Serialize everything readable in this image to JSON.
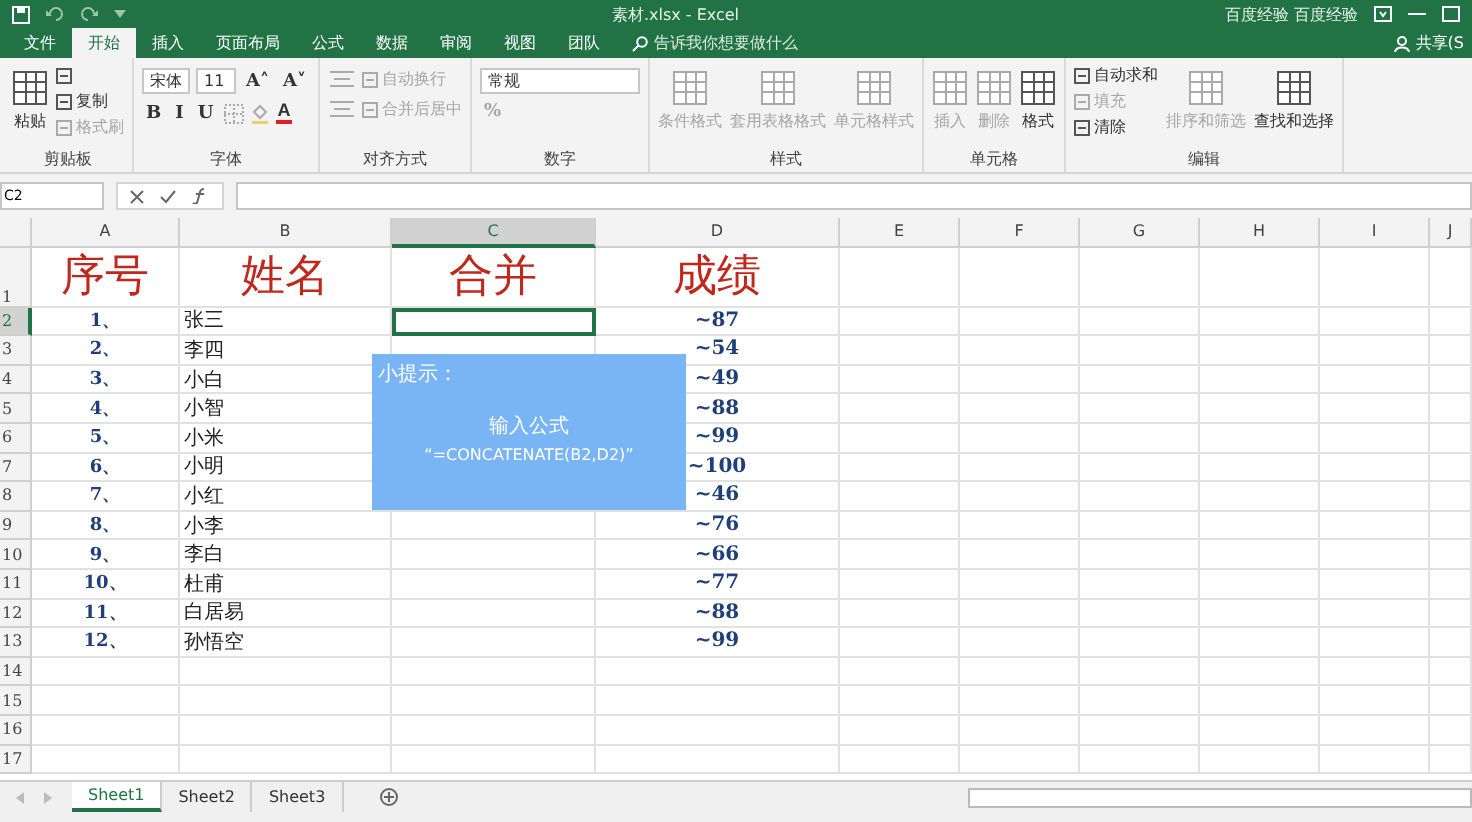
{
  "window": {
    "title": "素材.xlsx - Excel",
    "user": "百度经验 百度经验",
    "share": "共享(S"
  },
  "ribbon_tabs": [
    {
      "label": "文件",
      "selected": false
    },
    {
      "label": "开始",
      "selected": true
    },
    {
      "label": "插入",
      "selected": false
    },
    {
      "label": "页面布局",
      "selected": false
    },
    {
      "label": "公式",
      "selected": false
    },
    {
      "label": "数据",
      "selected": false
    },
    {
      "label": "审阅",
      "selected": false
    },
    {
      "label": "视图",
      "selected": false
    },
    {
      "label": "团队",
      "selected": false
    }
  ],
  "tell_me": {
    "placeholder": "告诉我你想要做什么"
  },
  "ribbon": {
    "groups": [
      {
        "label": "剪贴板",
        "items": [
          {
            "kind": "big",
            "label": "粘贴",
            "disabled": false
          },
          {
            "kind": "small",
            "disabled": false
          },
          {
            "kind": "small",
            "label": "复制",
            "disabled": false
          },
          {
            "kind": "small",
            "label": "格式刷",
            "disabled": true
          }
        ]
      },
      {
        "label": "字体",
        "top_row": [
          {
            "kind": "field",
            "label": "宋体",
            "disabled": false
          },
          {
            "kind": "field",
            "label": "11",
            "disabled": false
          },
          {
            "kind": "char",
            "label": "A˄",
            "disabled": false
          },
          {
            "kind": "char",
            "label": "A˅",
            "disabled": false
          }
        ],
        "bottom_row": [
          {
            "kind": "char",
            "label": "B",
            "disabled": false
          },
          {
            "kind": "char",
            "label": "I",
            "disabled": false
          },
          {
            "kind": "char",
            "label": "U",
            "disabled": false
          },
          {
            "kind": "border",
            "disabled": true
          },
          {
            "kind": "fill",
            "disabled": true
          },
          {
            "kind": "fontcolor",
            "label": "A",
            "disabled": false
          }
        ]
      },
      {
        "label": "对齐方式",
        "top_row": [
          {
            "kind": "align",
            "disabled": true
          },
          {
            "kind": "small",
            "label": "自动换行",
            "disabled": true
          }
        ],
        "bottom_row": [
          {
            "kind": "align",
            "disabled": true
          },
          {
            "kind": "small",
            "label": "合并后居中",
            "disabled": true
          }
        ]
      },
      {
        "label": "数字",
        "top_row": [
          {
            "kind": "field",
            "label": "常规",
            "disabled": false
          }
        ],
        "bottom_row": [
          {
            "kind": "char",
            "label": "%",
            "disabled": true
          }
        ]
      },
      {
        "label": "样式",
        "items": [
          {
            "kind": "big",
            "label": "条件格式",
            "disabled": true
          },
          {
            "kind": "big",
            "label": "套用表格格式",
            "disabled": true
          },
          {
            "kind": "big",
            "label": "单元格样式",
            "disabled": true
          }
        ]
      },
      {
        "label": "单元格",
        "items": [
          {
            "kind": "big",
            "label": "插入",
            "disabled": true
          },
          {
            "kind": "big",
            "label": "删除",
            "disabled": true
          },
          {
            "kind": "big",
            "label": "格式",
            "disabled": false
          }
        ]
      },
      {
        "label": "编辑",
        "items": [
          {
            "kind": "small",
            "label": "自动求和",
            "disabled": false
          },
          {
            "kind": "small",
            "label": "填充",
            "disabled": true
          },
          {
            "kind": "small",
            "label": "清除",
            "disabled": false
          },
          {
            "kind": "big",
            "label": "排序和筛选",
            "disabled": true
          },
          {
            "kind": "big",
            "label": "查找和选择",
            "disabled": false
          }
        ]
      }
    ]
  },
  "name_box": "C2",
  "grid": {
    "columns": [
      {
        "label": "A",
        "selected": false
      },
      {
        "label": "B",
        "selected": false
      },
      {
        "label": "C",
        "selected": true
      },
      {
        "label": "D",
        "selected": false
      },
      {
        "label": "E",
        "selected": false
      },
      {
        "label": "F",
        "selected": false
      },
      {
        "label": "G",
        "selected": false
      },
      {
        "label": "H",
        "selected": false
      },
      {
        "label": "I",
        "selected": false
      },
      {
        "label": "J",
        "selected": false
      }
    ],
    "header_row": {
      "number": "1",
      "selected": false,
      "cells": [
        "序号",
        "姓名",
        "合并",
        "成绩"
      ]
    },
    "rows": [
      {
        "number": "2",
        "selected": true,
        "seq": "1、",
        "name": "张三",
        "score": "~87"
      },
      {
        "number": "3",
        "selected": false,
        "seq": "2、",
        "name": "李四",
        "score": "~54"
      },
      {
        "number": "4",
        "selected": false,
        "seq": "3、",
        "name": "小白",
        "score": "~49"
      },
      {
        "number": "5",
        "selected": false,
        "seq": "4、",
        "name": "小智",
        "score": "~88"
      },
      {
        "number": "6",
        "selected": false,
        "seq": "5、",
        "name": "小米",
        "score": "~99"
      },
      {
        "number": "7",
        "selected": false,
        "seq": "6、",
        "name": "小明",
        "score": "~100"
      },
      {
        "number": "8",
        "selected": false,
        "seq": "7、",
        "name": "小红",
        "score": "~46"
      },
      {
        "number": "9",
        "selected": false,
        "seq": "8、",
        "name": "小李",
        "score": "~76"
      },
      {
        "number": "10",
        "selected": false,
        "seq": "9、",
        "name": "李白",
        "score": "~66"
      },
      {
        "number": "11",
        "selected": false,
        "seq": "10、",
        "name": "杜甫",
        "score": "~77"
      },
      {
        "number": "12",
        "selected": false,
        "seq": "11、",
        "name": "白居易",
        "score": "~88"
      },
      {
        "number": "13",
        "selected": false,
        "seq": "12、",
        "name": "孙悟空",
        "score": "~99"
      },
      {
        "number": "14",
        "selected": false
      },
      {
        "number": "15",
        "selected": false
      },
      {
        "number": "16",
        "selected": false
      },
      {
        "number": "17",
        "selected": false
      }
    ]
  },
  "tip": {
    "title": "小提示：",
    "line1": "输入公式",
    "line2": "“=CONCATENATE(B2,D2)”"
  },
  "sheet_tabs": [
    {
      "label": "Sheet1",
      "selected": true
    },
    {
      "label": "Sheet2",
      "selected": false
    },
    {
      "label": "Sheet3",
      "selected": false
    }
  ]
}
